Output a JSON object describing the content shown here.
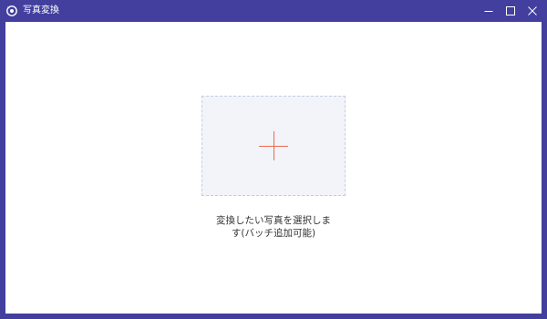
{
  "window": {
    "title": "写真変換",
    "app_icon": "camera-refresh-icon",
    "controls": [
      "minimize-icon",
      "maximize-icon",
      "close-icon"
    ]
  },
  "drop_zone": {
    "icon": "plus-icon",
    "hint_line1": "変換したい写真を選択しま",
    "hint_line2": "す(バッチ追加可能)"
  },
  "colors": {
    "frame": "#423f9e",
    "content_bg": "#ffffff",
    "drop_bg": "#f2f4f9",
    "drop_border": "#c3cce0",
    "accent": "#ec6a4e"
  }
}
